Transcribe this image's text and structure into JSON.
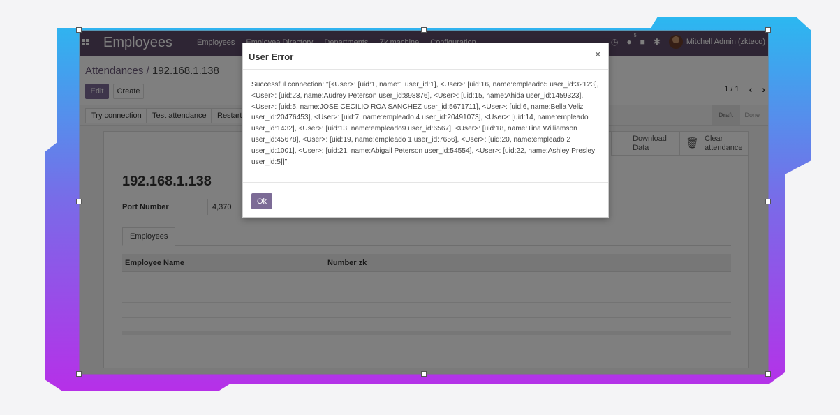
{
  "navbar": {
    "app_title": "Employees",
    "menu": [
      "Employees",
      "Employee Directory",
      "Departments",
      "Zk machine",
      "Configuration"
    ],
    "messages_badge": "5",
    "user_name": "Mitchell Admin (zkteco)"
  },
  "breadcrumb": {
    "parent": "Attendances",
    "separator": " / ",
    "current": "192.168.1.138"
  },
  "actions": {
    "edit_label": "Edit",
    "create_label": "Create"
  },
  "pager": {
    "value": "1 / 1"
  },
  "header_buttons": [
    "Try connection",
    "Test attendance",
    "Restart"
  ],
  "stages": {
    "active": "Draft",
    "next": "Done"
  },
  "smart_buttons": {
    "download_line1": "Download",
    "download_line2": "Data",
    "clear_line1": "Clear",
    "clear_line2": "attendance"
  },
  "record": {
    "title": "192.168.1.138",
    "port_label": "Port Number",
    "port_value": "4,370"
  },
  "tabs": [
    "Employees"
  ],
  "table": {
    "columns": [
      "Employee Name",
      "Number zk"
    ]
  },
  "dialog": {
    "title": "User Error",
    "close_glyph": "×",
    "message": "Successful connection:  \"[<User>: [uid:1, name:1 user_id:1], <User>: [uid:16, name:empleado5 user_id:32123], <User>: [uid:23, name:Audrey Peterson user_id:898876], <User>: [uid:15, name:Ahida user_id:1459323], <User>: [uid:5, name:JOSE CECILIO ROA SANCHEZ user_id:5671711], <User>: [uid:6, name:Bella Veliz user_id:20476453], <User>: [uid:7, name:empleado 4 user_id:20491073], <User>: [uid:14, name:empleado user_id:1432], <User>: [uid:13, name:empleado9 user_id:6567], <User>: [uid:18, name:Tina Williamson user_id:45678], <User>: [uid:19, name:empleado 1 user_id:7656], <User>: [uid:20, name:empleado 2 user_id:1001], <User>: [uid:21, name:Abigail Peterson user_id:54554], <User>: [uid:22, name:Ashley Presley user_id:5]]\".",
    "ok_label": "Ok"
  },
  "icons": {
    "apps": "apps-grid-icon",
    "clock": "clock-icon",
    "chat": "chat-icon",
    "gift": "gift-icon",
    "bug": "bug-icon",
    "prev": "chevron-left-icon",
    "next": "chevron-right-icon",
    "trash": "trash-icon"
  },
  "colors": {
    "navbar": "#5c4a68",
    "primary_button": "#7c6b96",
    "frame_gradient_top": "#2bb8f0",
    "frame_gradient_bottom": "#b630e8"
  }
}
